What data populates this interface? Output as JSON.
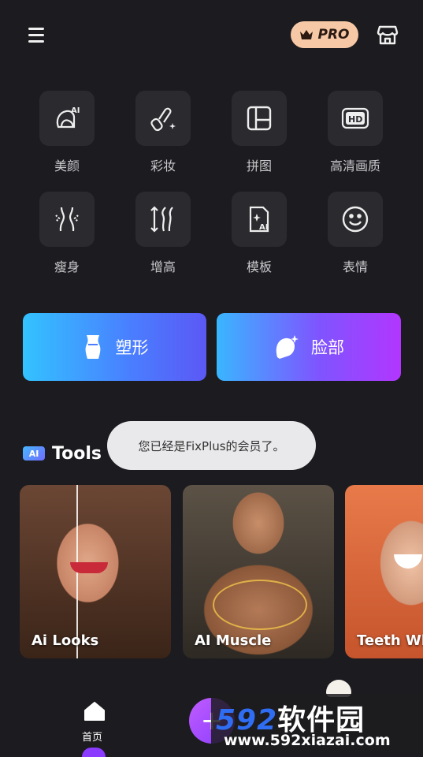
{
  "header": {
    "pro_label": "PRO"
  },
  "features": [
    {
      "label": "美颜",
      "icon": "ai-face-icon"
    },
    {
      "label": "彩妆",
      "icon": "makeup-brush-icon"
    },
    {
      "label": "拼图",
      "icon": "collage-icon"
    },
    {
      "label": "高清画质",
      "icon": "hd-icon"
    },
    {
      "label": "瘦身",
      "icon": "slim-body-icon"
    },
    {
      "label": "增高",
      "icon": "height-icon"
    },
    {
      "label": "模板",
      "icon": "ai-template-icon"
    },
    {
      "label": "表情",
      "icon": "smile-face-icon"
    }
  ],
  "big_buttons": {
    "shape": "塑形",
    "face": "脸部"
  },
  "ai_tools": {
    "badge": "AI",
    "title": "Tools",
    "cards": [
      "Ai Looks",
      "AI Muscle",
      "Teeth Wh"
    ]
  },
  "toast": "您已经是FixPlus的会员了。",
  "bottom_nav": {
    "home_label": "首页",
    "add_symbol": "+"
  },
  "watermark": {
    "digits": "592",
    "cn": "软件园",
    "url": "www.592xiazai.com"
  },
  "colors": {
    "accent_purple": "#8a3dff",
    "accent_blue": "#3ab8ff",
    "pro_badge": "#f6c8a6"
  }
}
